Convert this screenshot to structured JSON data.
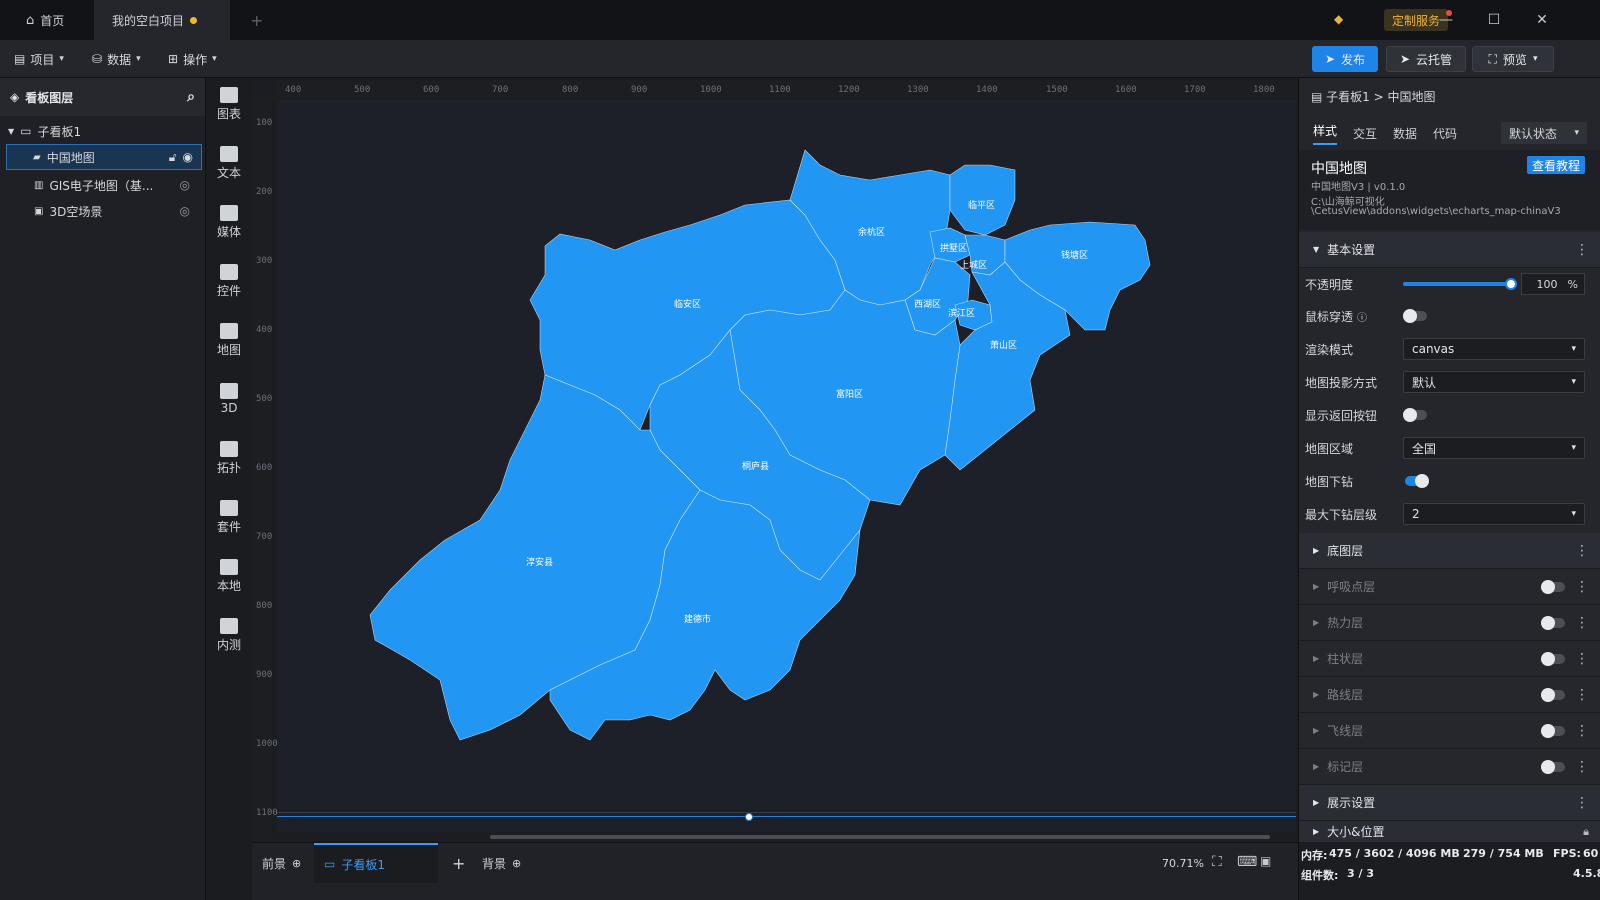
{
  "titlebar": {
    "home_tab": "首页",
    "project_tab": "我的空白项目",
    "new_tab": "+",
    "custom_service": "定制服务",
    "minimize": "—",
    "maximize": "☐",
    "close": "✕"
  },
  "toolbar": {
    "menus": [
      "项目",
      "数据",
      "操作"
    ],
    "publish": "发布",
    "cloud_host": "云托管",
    "preview": "预览"
  },
  "layers": {
    "title": "看板图层",
    "group": "子看板1",
    "items": [
      "中国地图",
      "GIS电子地图（基...",
      "3D空场景"
    ]
  },
  "components": [
    "图表",
    "文本",
    "媒体",
    "控件",
    "地图",
    "3D",
    "拓扑",
    "套件",
    "本地",
    "内测"
  ],
  "ruler": {
    "top": [
      "400",
      "500",
      "600",
      "700",
      "800",
      "900",
      "1000",
      "1100",
      "1200",
      "1300",
      "1400",
      "1500",
      "1600",
      "1700",
      "1800"
    ],
    "left": [
      "100",
      "200",
      "300",
      "400",
      "500",
      "600",
      "700",
      "800",
      "900",
      "1000",
      "1100"
    ]
  },
  "map": {
    "districts": [
      "临平区",
      "余杭区",
      "拱墅区",
      "上城区",
      "钱塘区",
      "临安区",
      "西湖区",
      "滨江区",
      "萧山区",
      "富阳区",
      "桐庐县",
      "淳安县",
      "建德市"
    ],
    "fill": "#2196f3",
    "border": "#ffffff"
  },
  "bottom": {
    "foreground": "前景",
    "board": "子看板1",
    "add": "+",
    "background": "背景",
    "zoom": "70.71%"
  },
  "panel": {
    "breadcrumb": "子看板1 > 中国地图",
    "tabs": [
      "样式",
      "交互",
      "数据",
      "代码"
    ],
    "state": "默认状态",
    "widget_title": "中国地图",
    "tutorial": "查看教程",
    "version": "中国地图V3 | v0.1.0",
    "path1": "C:\\山海鲸可视化",
    "path2": "\\CetusView\\addons\\widgets\\echarts_map-chinaV3",
    "basic": "基本设置",
    "opacity_label": "不透明度",
    "opacity_value": "100",
    "opacity_fraction": 1.0,
    "opacity_unit": "%",
    "mouse_through": "鼠标穿透",
    "render_mode": "渲染模式",
    "render_mode_value": "canvas",
    "projection": "地图投影方式",
    "projection_value": "默认",
    "back_button": "显示返回按钮",
    "region": "地图区域",
    "region_value": "全国",
    "drilldown": "地图下钻",
    "max_level": "最大下钻层级",
    "max_level_value": "2",
    "sections": [
      "底图层",
      "呼吸点层",
      "热力层",
      "柱状层",
      "路线层",
      "飞线层",
      "标记层",
      "展示设置",
      "大小&位置"
    ]
  },
  "status": {
    "memory_label": "内存:",
    "memory": "475 / 3602 / 4096 MB",
    "memory2": "279 / 754 MB",
    "fps_label": "FPS:",
    "fps": "60",
    "components_label": "组件数:",
    "components": "3 / 3",
    "version": "4.5.8"
  },
  "colors": {
    "accent": "#1f84e8",
    "map_fill": "#2196f3",
    "warning": "#f5b62b"
  }
}
